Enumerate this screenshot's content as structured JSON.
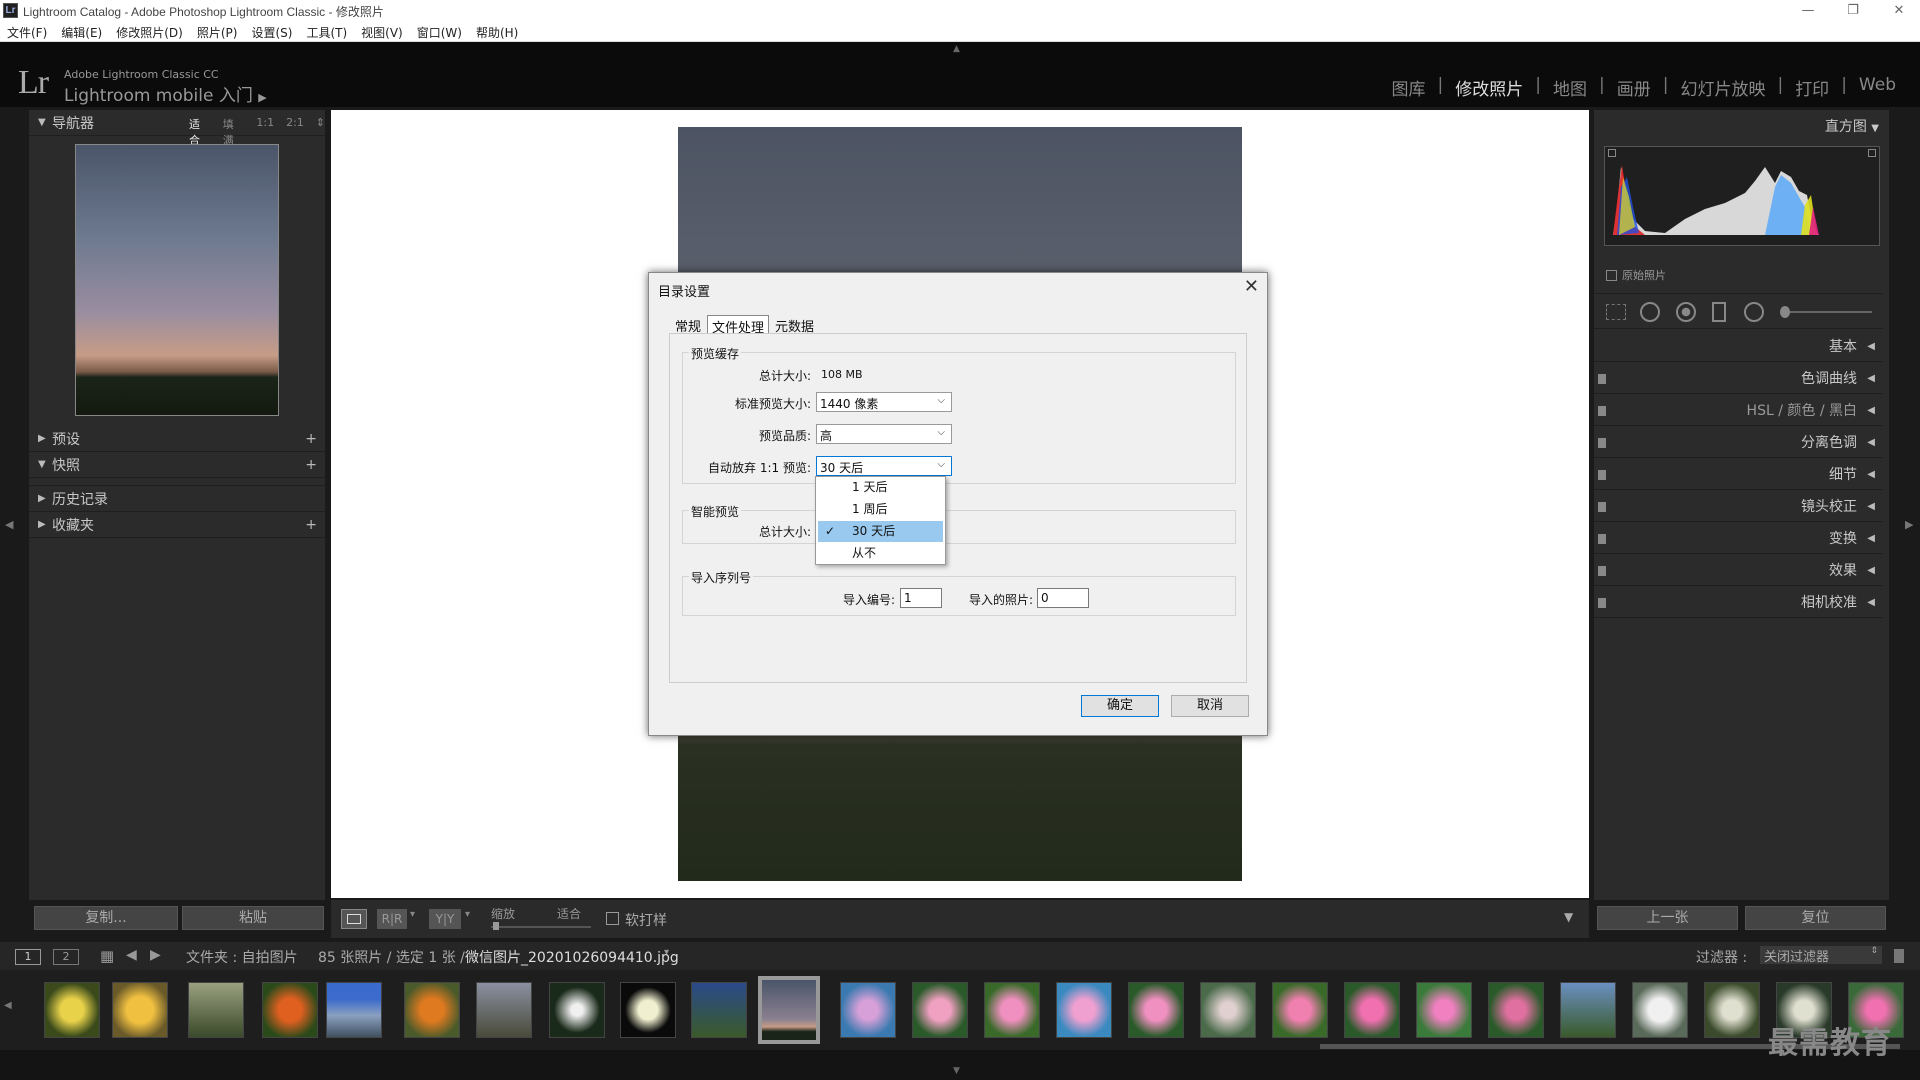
{
  "window": {
    "title": "Lightroom Catalog - Adobe Photoshop Lightroom Classic - 修改照片",
    "app_icon": "Lr"
  },
  "menu": [
    "文件(F)",
    "编辑(E)",
    "修改照片(D)",
    "照片(P)",
    "设置(S)",
    "工具(T)",
    "视图(V)",
    "窗口(W)",
    "帮助(H)"
  ],
  "identity": {
    "logo": "Lr",
    "line1": "Adobe Lightroom Classic CC",
    "line2": "Lightroom mobile 入门"
  },
  "modules": [
    {
      "label": "图库",
      "active": false
    },
    {
      "label": "修改照片",
      "active": true
    },
    {
      "label": "地图",
      "active": false
    },
    {
      "label": "画册",
      "active": false
    },
    {
      "label": "幻灯片放映",
      "active": false
    },
    {
      "label": "打印",
      "active": false
    },
    {
      "label": "Web",
      "active": false
    }
  ],
  "navigator": {
    "title": "导航器",
    "opts": [
      "适合",
      "填满",
      "1:1",
      "2:1"
    ]
  },
  "left_sections": [
    "预设",
    "快照",
    "历史记录",
    "收藏夹"
  ],
  "left_buttons": {
    "copy": "复制...",
    "paste": "粘贴"
  },
  "toolbar": {
    "zoom_label": "缩放",
    "fit_label": "适合",
    "softproof": "软打样"
  },
  "right": {
    "histogram": "直方图",
    "original": "原始照片",
    "sections": [
      "基本",
      "色调曲线",
      "HSL / 颜色 / 黑白",
      "分离色调",
      "细节",
      "镜头校正",
      "变换",
      "效果",
      "相机校准"
    ],
    "prev": "上一张",
    "reset": "复位"
  },
  "filmbar": {
    "view1": "1",
    "view2": "2",
    "path": "文件夹 : 自拍图片",
    "count": "85 张照片 / 选定 1 张 /",
    "filename": "微信图片_20201026094410.jpg",
    "filter_label": "过滤器 :",
    "filter_value": "关闭过滤器"
  },
  "dialog": {
    "title": "目录设置",
    "tabs": [
      {
        "label": "常规",
        "active": false
      },
      {
        "label": "文件处理",
        "active": true
      },
      {
        "label": "元数据",
        "active": false
      }
    ],
    "preview_cache": {
      "label": "预览缓存",
      "total_label": "总计大小:",
      "total_value": "108 MB",
      "std_label": "标准预览大小:",
      "std_value": "1440 像素",
      "quality_label": "预览品质:",
      "quality_value": "高",
      "discard_label": "自动放弃 1:1 预览:",
      "discard_value": "30 天后"
    },
    "smart_preview": {
      "label": "智能预览",
      "total_label": "总计大小:"
    },
    "import_seq": {
      "label": "导入序列号",
      "num_label": "导入编号:",
      "num_value": "1",
      "photos_label": "导入的照片:",
      "photos_value": "0"
    },
    "ok": "确定",
    "cancel": "取消"
  },
  "dropdown": {
    "options": [
      "1 天后",
      "1 周后",
      "30 天后",
      "从不"
    ],
    "selected": "30 天后"
  },
  "watermark": "最需教育",
  "colors": {
    "accent_select": "#99c9ef",
    "primary_border": "#0078d7"
  }
}
